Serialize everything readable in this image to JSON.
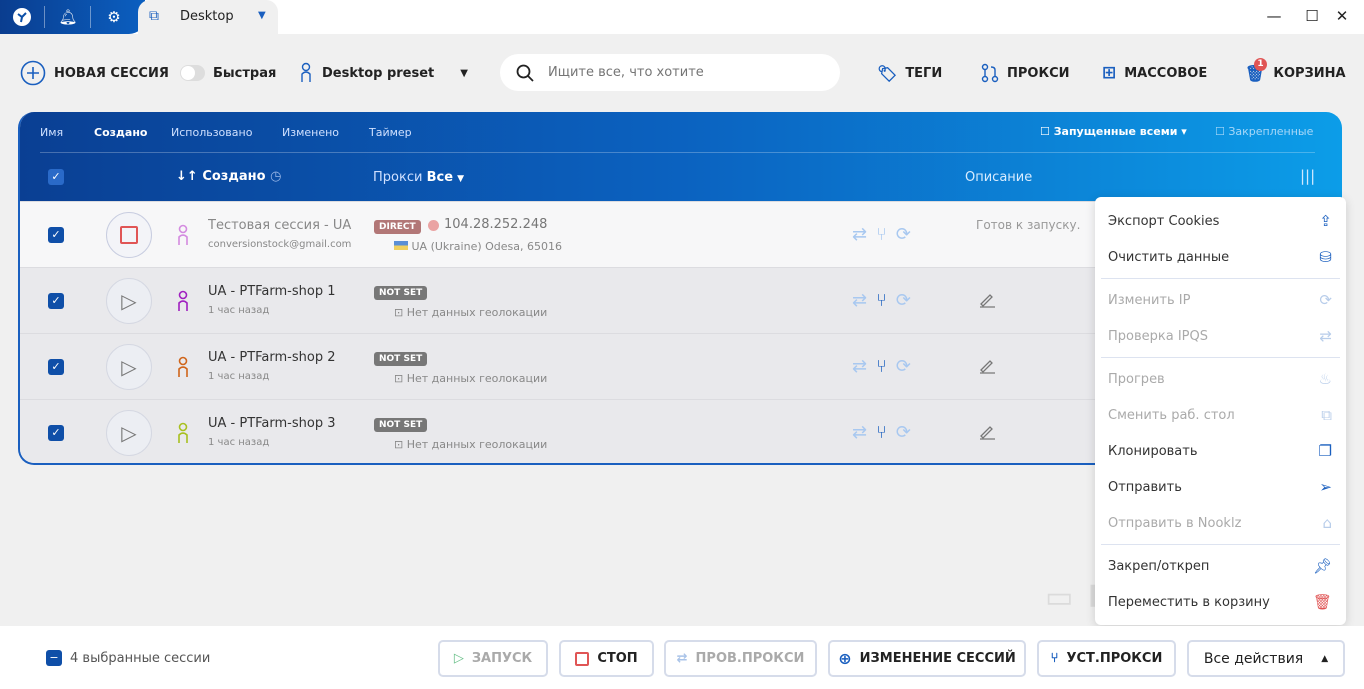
{
  "titlebar": {
    "tab_label": "Desktop"
  },
  "toolbar": {
    "new_session": "НОВАЯ СЕССИЯ",
    "quick_label": "Быстрая",
    "quick_on": false,
    "preset": "Desktop preset",
    "search_placeholder": "Ищите все, что хотите",
    "tags": "ТЕГИ",
    "proxy": "ПРОКСИ",
    "bulk": "МАССОВОЕ",
    "trash": "КОРЗИНА",
    "trash_count": "1"
  },
  "table": {
    "sort_tabs": [
      "Имя",
      "Создано",
      "Использовано",
      "Изменено",
      "Таймер"
    ],
    "filter_running": "Запущенные всеми",
    "filter_pinned": "Закрепленные",
    "col_created": "Создано",
    "col_proxy": "Прокси",
    "col_proxy_filter": "Все",
    "col_desc": "Описание",
    "rows": [
      {
        "name": "Тестовая сессия - UA - PTFarm",
        "sub": "conversionstock@gmail.com",
        "badge": "DIRECT",
        "ip": "104.28.252.248",
        "geo": "UA (Ukraine) Odesa, 65016",
        "desc": "Готов к запуску.",
        "color": "#d48be0",
        "state": "running"
      },
      {
        "name": "UA - PTFarm-shop 1",
        "sub": "1 час назад",
        "badge": "NOT SET",
        "geo": "Нет данных геолокации",
        "color": "#a020c0",
        "state": "idle"
      },
      {
        "name": "UA - PTFarm-shop 2",
        "sub": "1 час назад",
        "badge": "NOT SET",
        "geo": "Нет данных геолокации",
        "color": "#d0651a",
        "state": "idle"
      },
      {
        "name": "UA - PTFarm-shop 3",
        "sub": "1 час назад",
        "badge": "NOT SET",
        "geo": "Нет данных геолокации",
        "color": "#a8c020",
        "state": "idle"
      }
    ]
  },
  "context_menu": [
    {
      "label": "Экспорт Cookies",
      "icon": "export-cookies-icon",
      "enabled": true
    },
    {
      "label": "Очистить данные",
      "icon": "clear-data-icon",
      "enabled": true
    },
    {
      "divider": true
    },
    {
      "label": "Изменить IP",
      "icon": "refresh-icon",
      "enabled": false
    },
    {
      "label": "Проверка IPQS",
      "icon": "check-proxy-icon",
      "enabled": false
    },
    {
      "divider": true
    },
    {
      "label": "Прогрев",
      "icon": "flame-icon",
      "enabled": false
    },
    {
      "label": "Сменить раб. стол",
      "icon": "desktop-icon",
      "enabled": false
    },
    {
      "label": "Клонировать",
      "icon": "clone-icon",
      "enabled": true
    },
    {
      "label": "Отправить",
      "icon": "send-icon",
      "enabled": true
    },
    {
      "label": "Отправить в Nooklz",
      "icon": "nooklz-icon",
      "enabled": false
    },
    {
      "divider": true
    },
    {
      "label": "Закреп/откреп",
      "icon": "pin-icon",
      "enabled": true
    },
    {
      "label": "Переместить в корзину",
      "icon": "trash-icon",
      "enabled": true
    }
  ],
  "bottom": {
    "selected": "4 выбранные сессии",
    "start": "ЗАПУСК",
    "stop": "СТОП",
    "check_proxy": "ПРОВ.ПРОКСИ",
    "change_sessions": "ИЗМЕНЕНИЕ СЕССИЙ",
    "set_proxy": "УСТ.ПРОКСИ",
    "all_actions": "Все действия"
  },
  "watermark": "ПАРТНЕРКИН",
  "colors": {
    "accent": "#1a5fbf",
    "danger": "#e05555"
  }
}
